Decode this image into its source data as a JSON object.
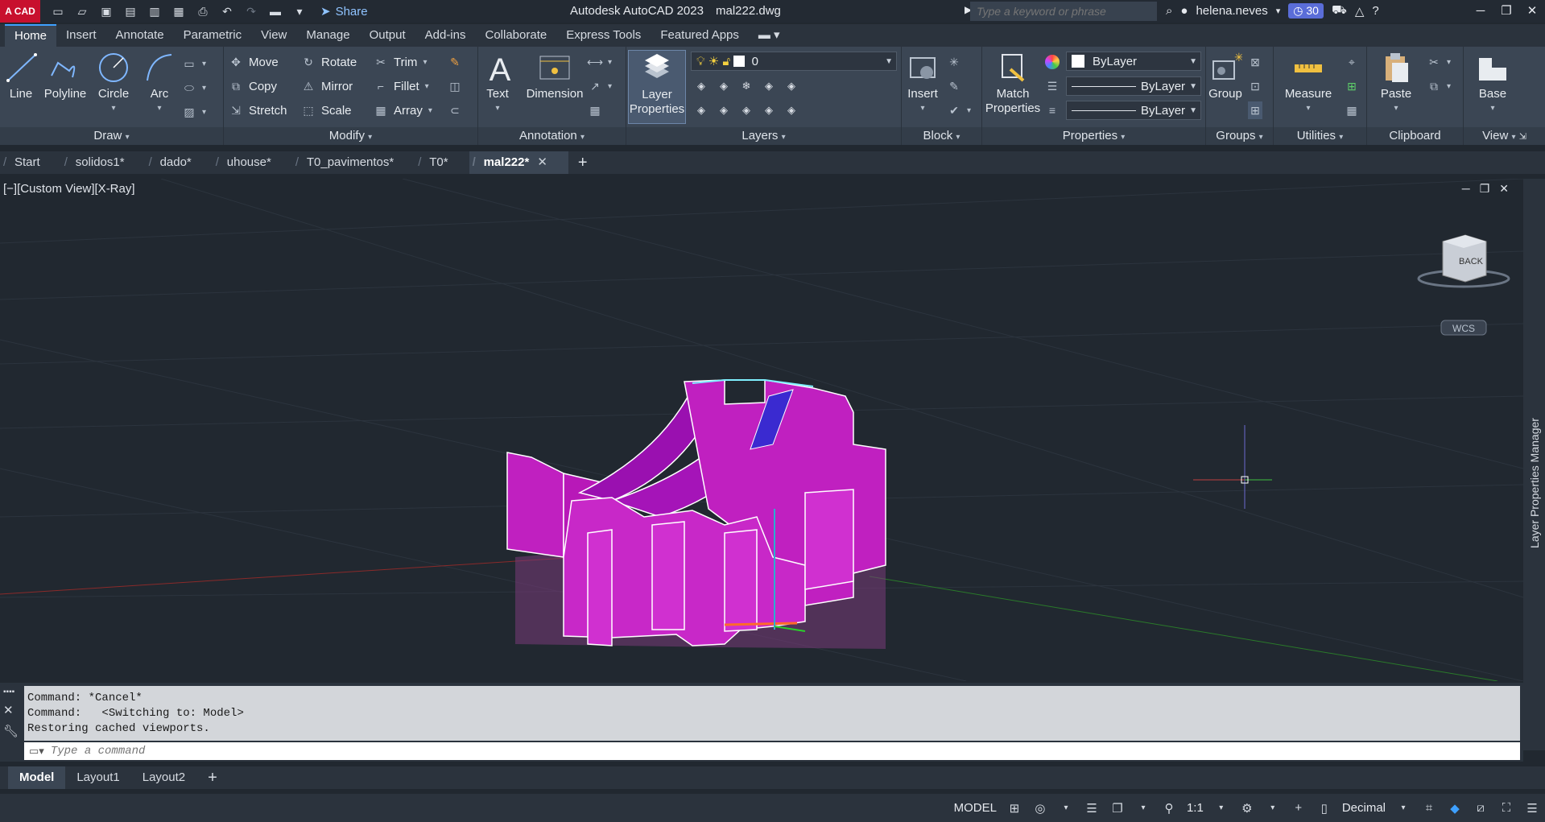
{
  "titlebar": {
    "logo": "A CAD",
    "share_label": "Share",
    "app_title": "Autodesk AutoCAD 2023",
    "file_title": "mal222.dwg",
    "search_placeholder": "Type a keyword or phrase",
    "user": "helena.neves",
    "time_badge": "30"
  },
  "ribbon_tabs": [
    "Home",
    "Insert",
    "Annotate",
    "Parametric",
    "View",
    "Manage",
    "Output",
    "Add-ins",
    "Collaborate",
    "Express Tools",
    "Featured Apps"
  ],
  "draw": {
    "title": "Draw",
    "line": "Line",
    "polyline": "Polyline",
    "circle": "Circle",
    "arc": "Arc"
  },
  "modify": {
    "title": "Modify",
    "move": "Move",
    "rotate": "Rotate",
    "trim": "Trim",
    "copy": "Copy",
    "mirror": "Mirror",
    "fillet": "Fillet",
    "stretch": "Stretch",
    "scale": "Scale",
    "array": "Array"
  },
  "annotation": {
    "title": "Annotation",
    "text": "Text",
    "dimension": "Dimension"
  },
  "layers": {
    "title": "Layers",
    "layer_properties_1": "Layer",
    "layer_properties_2": "Properties",
    "current_layer": "0"
  },
  "block": {
    "title": "Block",
    "insert": "Insert"
  },
  "properties": {
    "title": "Properties",
    "match_1": "Match",
    "match_2": "Properties",
    "color": "ByLayer",
    "linetype": "ByLayer",
    "lineweight": "ByLayer"
  },
  "groups": {
    "title": "Groups",
    "group": "Group"
  },
  "utilities": {
    "title": "Utilities",
    "measure": "Measure"
  },
  "clipboard": {
    "title": "Clipboard",
    "paste": "Paste"
  },
  "view": {
    "title": "View",
    "base": "Base"
  },
  "file_tabs": [
    "Start",
    "solidos1*",
    "dado*",
    "uhouse*",
    "T0_pavimentos*",
    "T0*",
    "mal222*"
  ],
  "viewport": {
    "label": "[−][Custom View][X-Ray]",
    "viewcube_face": "BACK",
    "wcs": "WCS"
  },
  "side_panel": {
    "label": "Layer Properties Manager"
  },
  "command": {
    "history": [
      "Command: *Cancel*",
      "Command:   <Switching to: Model>",
      "Restoring cached viewports."
    ],
    "placeholder": "Type a command"
  },
  "layout_tabs": [
    "Model",
    "Layout1",
    "Layout2"
  ],
  "status": {
    "model": "MODEL",
    "scale": "1:1",
    "units": "Decimal"
  },
  "colors": {
    "accent": "#3ea0ff",
    "model_fill": "#c020c0",
    "model_edge": "#ffffff",
    "background": "#212830"
  }
}
